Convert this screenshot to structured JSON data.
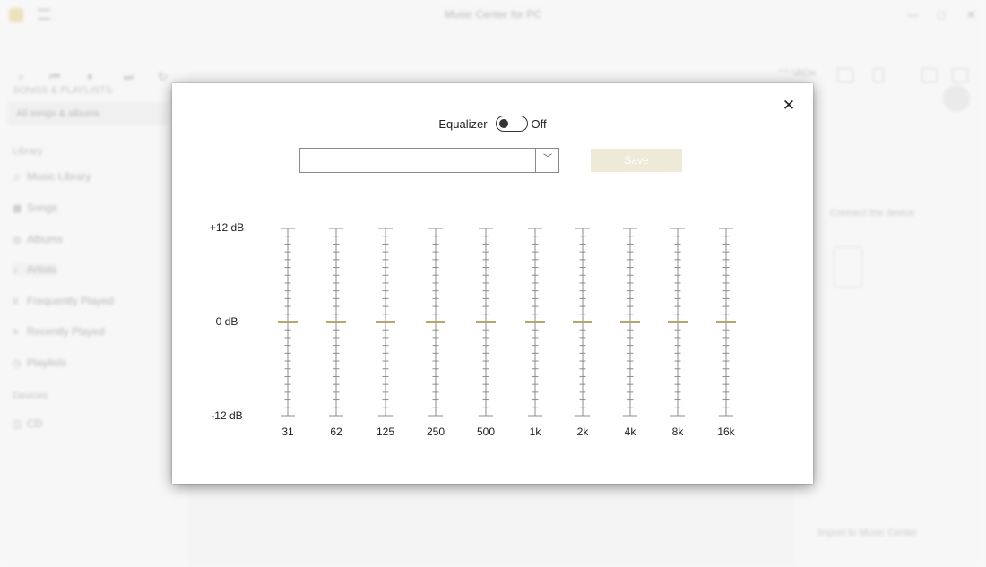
{
  "background": {
    "app_title": "Music Center for PC",
    "window_controls": [
      "—",
      "□",
      "✕"
    ],
    "toolbar": {
      "left_icons": [
        "⌕",
        "⏮",
        "⏸",
        "⏭",
        "↻"
      ],
      "search_text": "SEARCH"
    },
    "sidebar": {
      "head": "SONGS & PLAYLISTS",
      "selected": "All songs & albums",
      "section_library": "Library",
      "items": [
        {
          "icon": "♫",
          "label": "Music Library"
        },
        {
          "icon": "▦",
          "label": "Songs"
        },
        {
          "icon": "◎",
          "label": "Albums"
        },
        {
          "icon": "♪",
          "label": "Artists"
        },
        {
          "icon": "≡",
          "label": "Frequently Played"
        },
        {
          "icon": "≡",
          "label": "Recently Played"
        },
        {
          "icon": "◷",
          "label": "Playlists"
        }
      ],
      "section_other": "Devices",
      "other_items": [
        {
          "icon": "◫",
          "label": "CD"
        }
      ]
    },
    "right_pane": {
      "heading": "Connect the device",
      "footer": "Import to Music Center"
    }
  },
  "dialog": {
    "close_glyph": "✕",
    "equalizer_label": "Equalizer",
    "toggle_state": "Off",
    "toggle_on": false,
    "preset_value": "",
    "chevron_glyph": "﹀",
    "save_label": "Save",
    "db_labels": {
      "top": "+12 dB",
      "mid": "0 dB",
      "bottom": "-12 dB"
    },
    "db_range": [
      -12,
      12
    ],
    "bands": [
      {
        "freq": "31",
        "gain": 0
      },
      {
        "freq": "62",
        "gain": 0
      },
      {
        "freq": "125",
        "gain": 0
      },
      {
        "freq": "250",
        "gain": 0
      },
      {
        "freq": "500",
        "gain": 0
      },
      {
        "freq": "1k",
        "gain": 0
      },
      {
        "freq": "2k",
        "gain": 0
      },
      {
        "freq": "4k",
        "gain": 0
      },
      {
        "freq": "8k",
        "gain": 0
      },
      {
        "freq": "16k",
        "gain": 0
      }
    ],
    "colors": {
      "thumb": "#b9a56e",
      "track": "#8c8c8c",
      "save_bg": "#efe9d8"
    }
  }
}
